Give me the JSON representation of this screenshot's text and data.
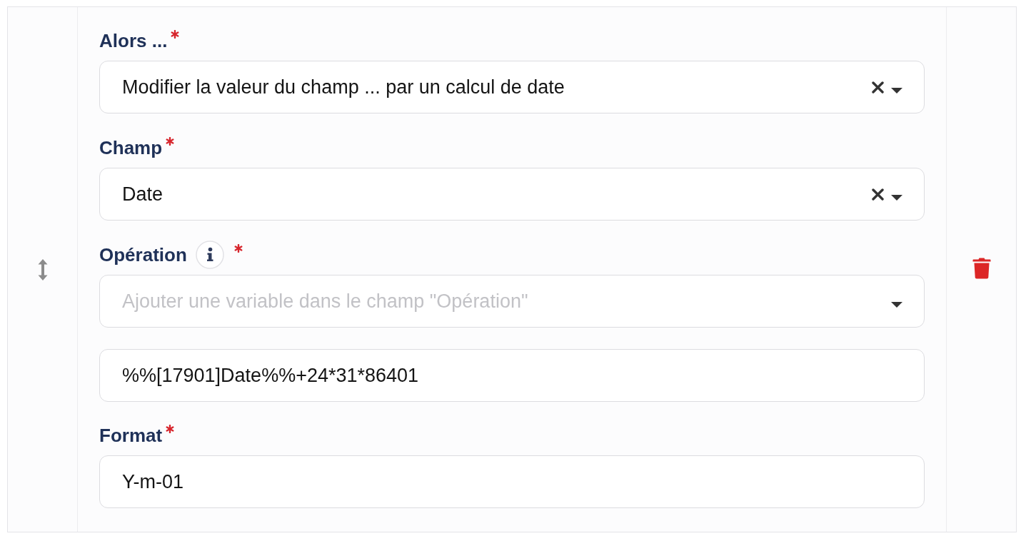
{
  "form": {
    "fields": [
      {
        "kind": "select",
        "label": "Alors ...",
        "required": true,
        "info": false,
        "value": "Modifier la valeur du champ ... par un calcul de date",
        "clearable": true
      },
      {
        "kind": "select",
        "label": "Champ",
        "required": true,
        "info": false,
        "value": "Date",
        "clearable": true
      },
      {
        "kind": "select",
        "label": "Opération",
        "required": true,
        "info": true,
        "placeholder": "Ajouter une variable dans le champ \"Opération\"",
        "clearable": false
      },
      {
        "kind": "text",
        "value": "%%[17901]Date%%+24*31*86401"
      },
      {
        "kind": "text",
        "label": "Format",
        "required": true,
        "info": false,
        "value": "Y-m-01"
      }
    ]
  }
}
